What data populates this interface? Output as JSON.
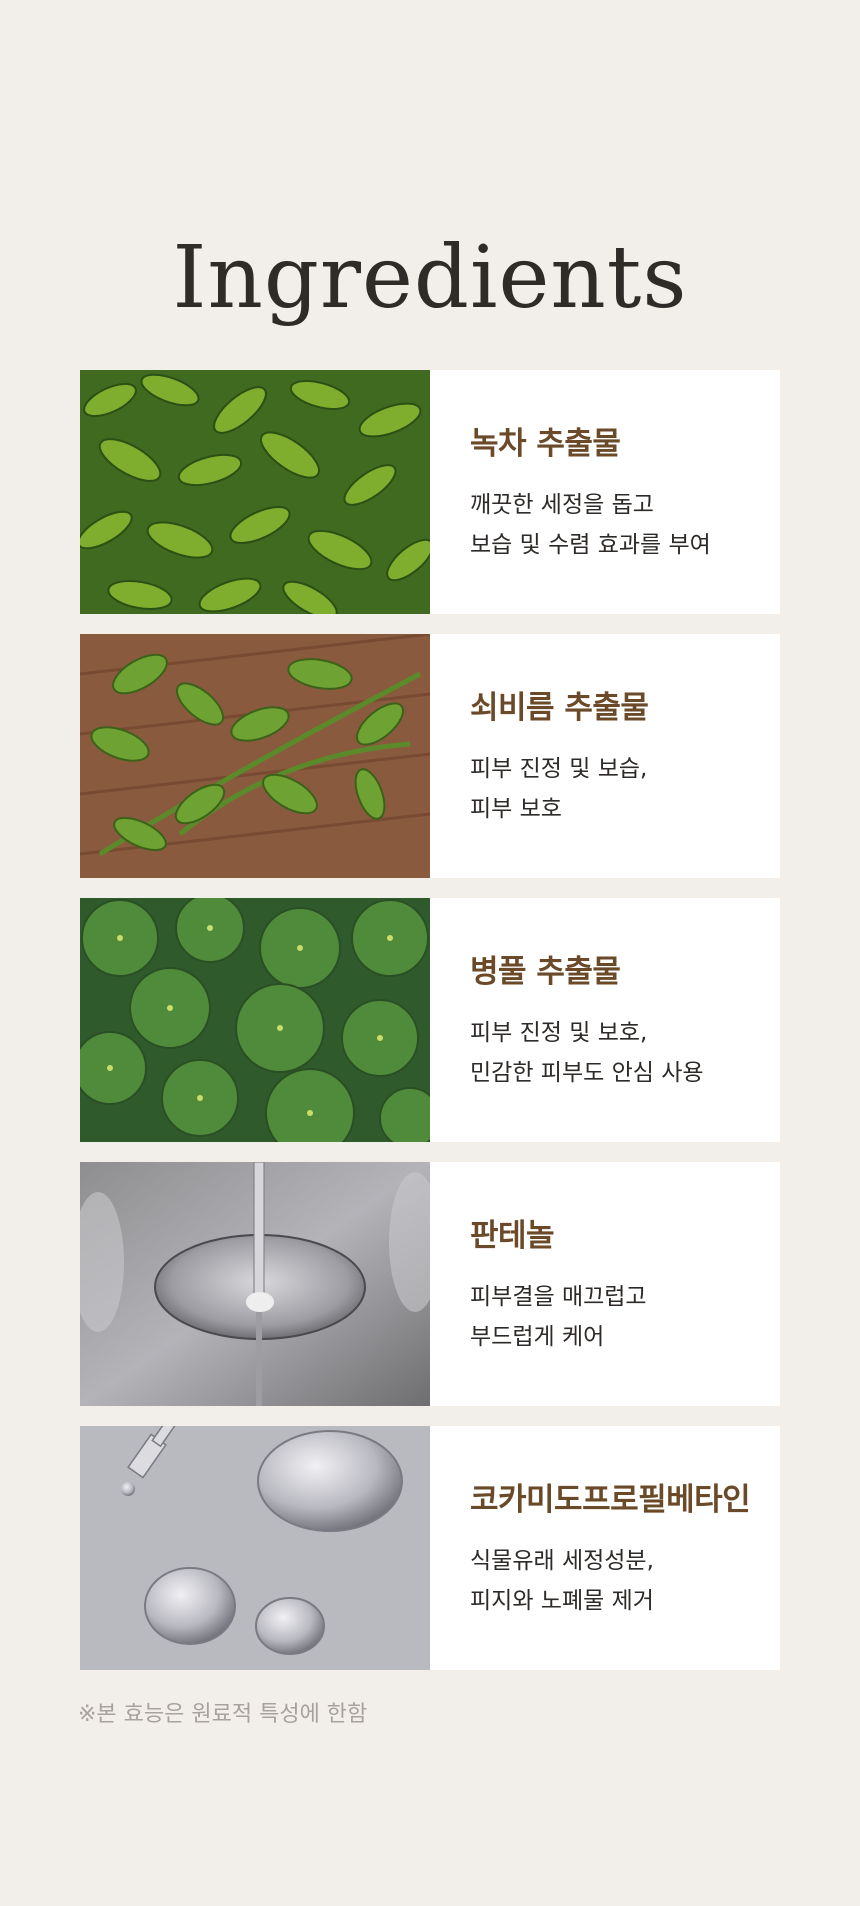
{
  "title": "Ingredients",
  "ingredients": [
    {
      "name": "녹차 추출물",
      "desc_line1": "깨끗한 세정을 돕고",
      "desc_line2": "보습 및 수렴 효과를 부여",
      "image": "green-tea-leaves"
    },
    {
      "name": "쇠비름 추출물",
      "desc_line1": "피부 진정 및 보습,",
      "desc_line2": "피부 보호",
      "image": "purslane-on-wood"
    },
    {
      "name": "병풀 추출물",
      "desc_line1": "피부 진정 및 보호,",
      "desc_line2": "민감한 피부도 안심 사용",
      "image": "centella-leaves"
    },
    {
      "name": "판테놀",
      "desc_line1": "피부결을 매끄럽고",
      "desc_line2": "부드럽게 케어",
      "image": "liquid-drop"
    },
    {
      "name": "코카미도프로필베타인",
      "desc_line1": "식물유래 세정성분,",
      "desc_line2": "피지와 노폐물 제거",
      "image": "water-droplets-dropper"
    }
  ],
  "note": "※본 효능은 원료적 특성에 한함",
  "colors": {
    "background": "#f2eee9",
    "accent": "#6b4a2a",
    "card": "#ffffff"
  }
}
